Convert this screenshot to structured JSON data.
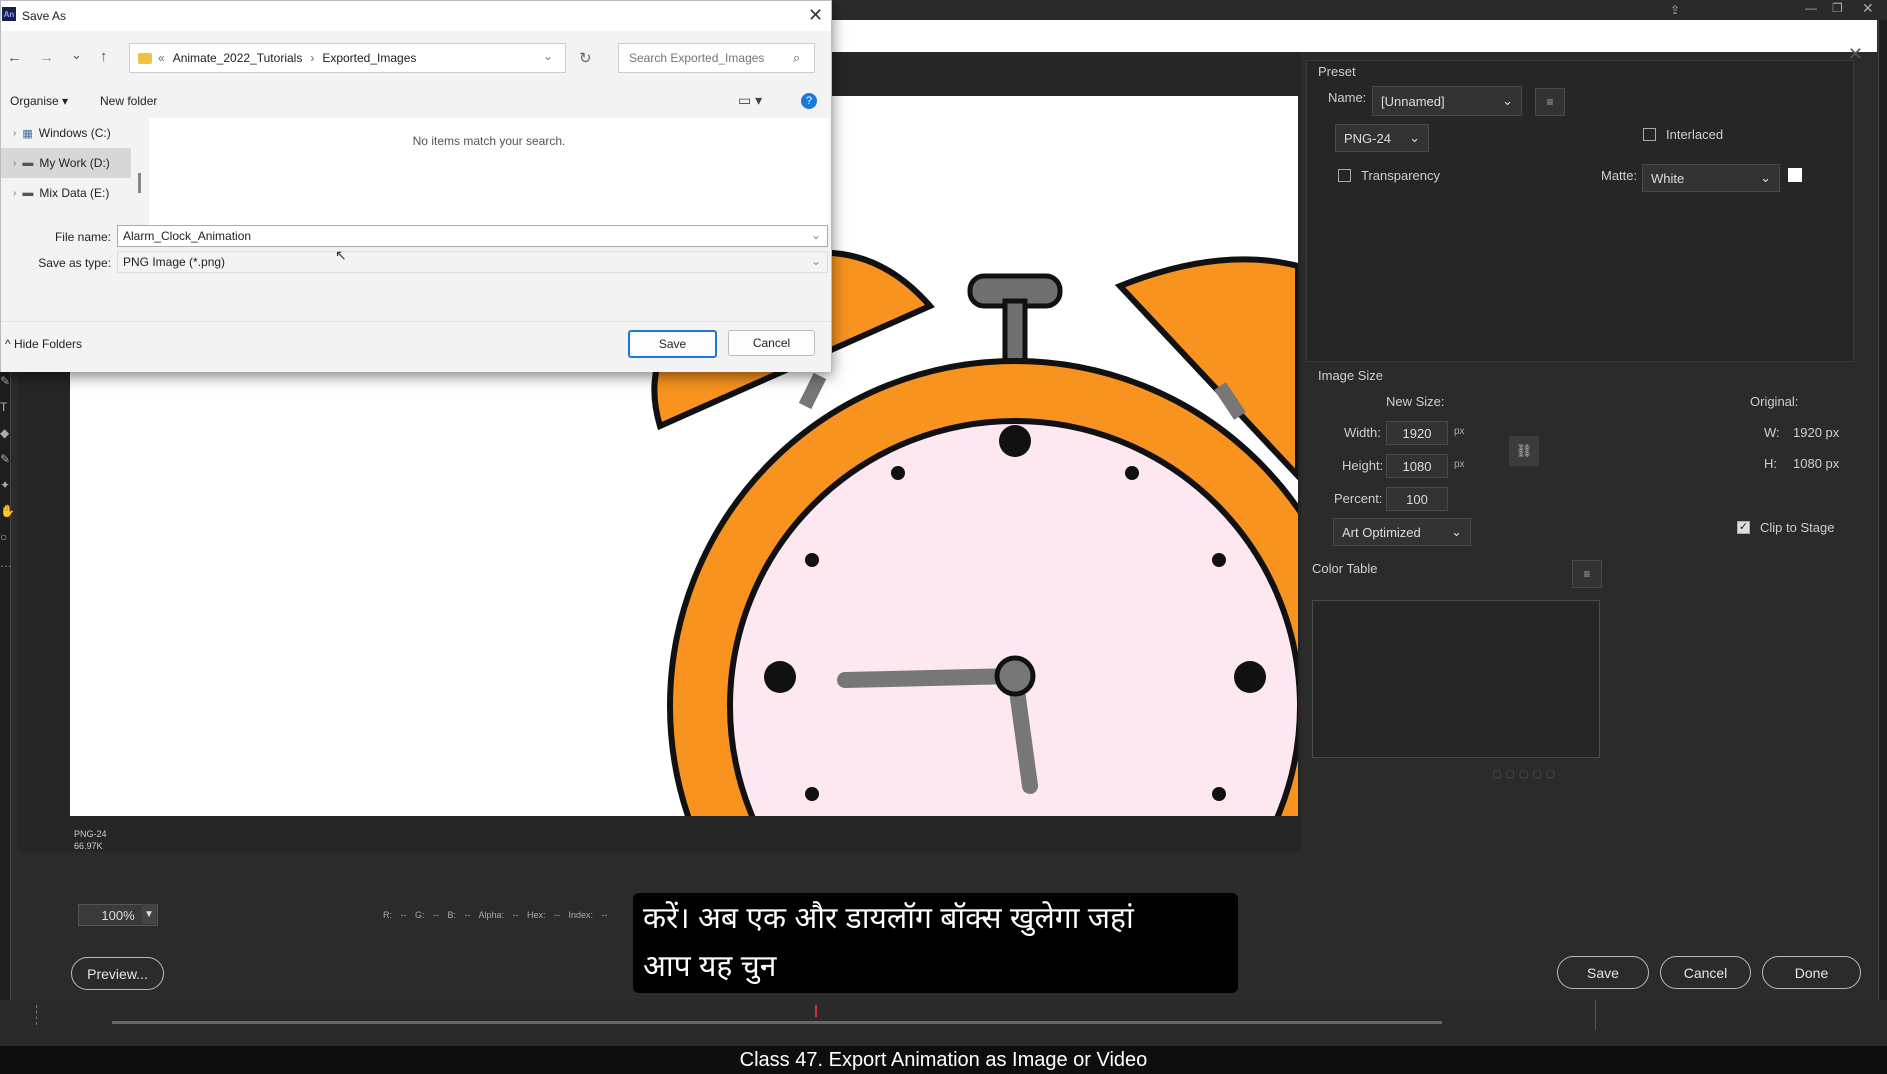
{
  "colors": {
    "accent_blue": "#1e78d7",
    "orange": "#f7931e",
    "clock_face": "#fde8f2"
  },
  "save_dialog": {
    "app_icon": "An",
    "title": "Save As",
    "path": {
      "prefix": "«",
      "parts": [
        "Animate_2022_Tutorials",
        "Exported_Images"
      ],
      "separator": "›"
    },
    "search_placeholder": "Search Exported_Images",
    "toolbar": {
      "organise": "Organise",
      "new_folder": "New folder"
    },
    "drives": [
      {
        "label": "Windows (C:)",
        "icon": "drive-windows-icon"
      },
      {
        "label": "My Work (D:)",
        "icon": "drive-icon"
      },
      {
        "label": "Mix Data (E:)",
        "icon": "drive-icon"
      }
    ],
    "empty_message": "No items match your search.",
    "file_name_label": "File name:",
    "file_name": "Alarm_Clock_Animation",
    "save_type_label": "Save as type:",
    "save_type": "PNG Image (*.png)",
    "hide_folders": "Hide Folders",
    "save_label": "Save",
    "cancel_label": "Cancel"
  },
  "export_settings": {
    "preset_heading": "Preset",
    "name_label": "Name:",
    "name_value": "[Unnamed]",
    "format": "PNG-24",
    "interlaced_label": "Interlaced",
    "transparency_label": "Transparency",
    "matte_label": "Matte:",
    "matte_value": "White",
    "image_size_heading": "Image Size",
    "new_size_label": "New Size:",
    "original_label": "Original:",
    "width_label": "Width:",
    "width_value": "1920",
    "height_label": "Height:",
    "height_value": "1080",
    "unit": "px",
    "percent_label": "Percent:",
    "percent_value": "100",
    "orig_w_label": "W:",
    "orig_w": "1920 px",
    "orig_h_label": "H:",
    "orig_h": "1080 px",
    "optimize": "Art Optimized",
    "clip_label": "Clip to Stage",
    "clip_checked": true,
    "color_table_heading": "Color Table"
  },
  "preview": {
    "format_line": "PNG-24",
    "size_line": "66.97K",
    "zoom": "100%",
    "readout": "R: --  G: --  B: --  Alpha: --  Hex: --  Index: --"
  },
  "buttons": {
    "preview": "Preview...",
    "save": "Save",
    "cancel": "Cancel",
    "done": "Done"
  },
  "subtitle": {
    "line1": "करें। अब एक और डायलॉग बॉक्स खुलेगा जहां",
    "line2": "आप यह चुन"
  },
  "footer": "Class 47. Export Animation as Image or Video"
}
